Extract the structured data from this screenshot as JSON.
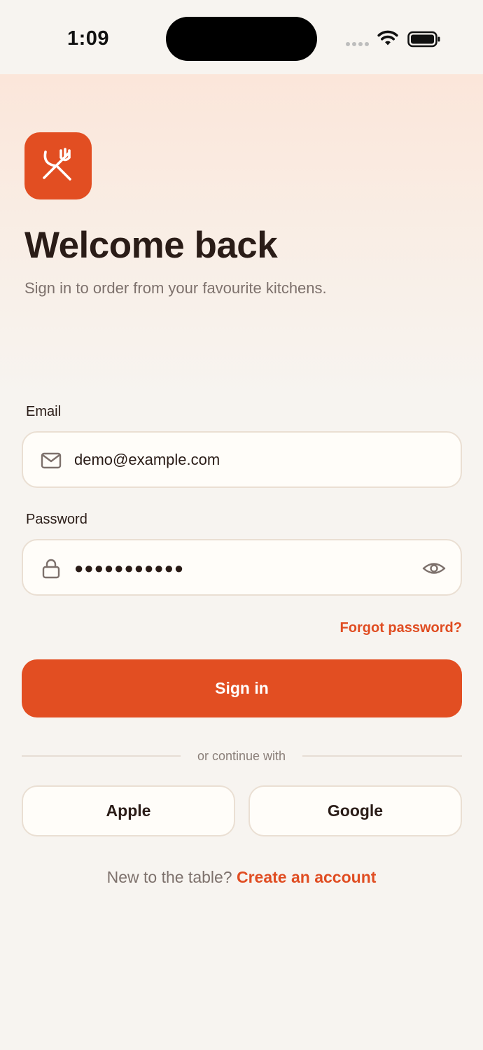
{
  "status_bar": {
    "time": "1:09"
  },
  "brand": {
    "logo_icon": "utensils-crossed-icon",
    "accent_color": "#e24e22"
  },
  "header": {
    "title": "Welcome back",
    "subtitle": "Sign in to order from your favourite kitchens."
  },
  "form": {
    "email_label": "Email",
    "email_value": "demo@example.com",
    "email_icon": "mail-icon",
    "password_label": "Password",
    "password_masked": "●●●●●●●●●●●",
    "password_icon": "lock-icon",
    "show_password_icon": "eye-icon",
    "forgot_password": "Forgot password?",
    "submit_label": "Sign in"
  },
  "social": {
    "divider_text": "or continue with",
    "apple_label": "Apple",
    "google_label": "Google"
  },
  "footer": {
    "prompt": "New to the table?",
    "link": "Create an account"
  }
}
